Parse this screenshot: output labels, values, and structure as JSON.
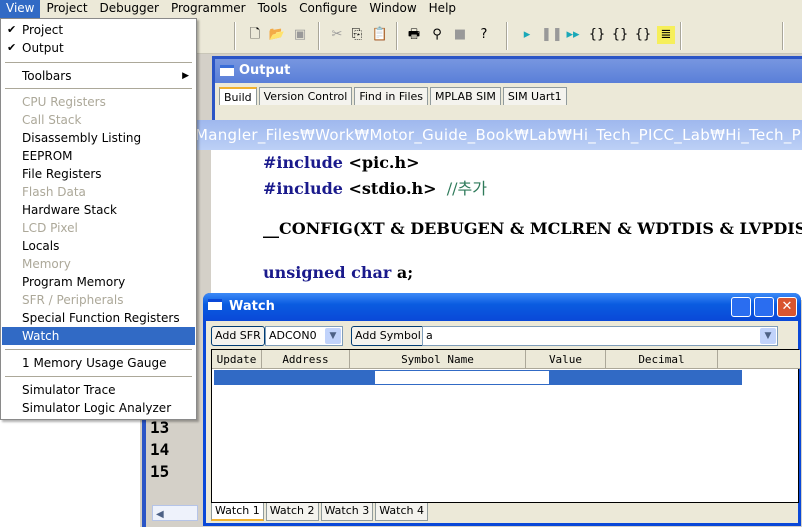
{
  "menubar": [
    "View",
    "Project",
    "Debugger",
    "Programmer",
    "Tools",
    "Configure",
    "Window",
    "Help"
  ],
  "view_menu": {
    "items": [
      {
        "label": "Project",
        "checked": true
      },
      {
        "label": "Output",
        "checked": true
      },
      {
        "label": "Toolbars",
        "submenu": true
      },
      {
        "label": "CPU Registers",
        "disabled": true
      },
      {
        "label": "Call Stack",
        "disabled": true
      },
      {
        "label": "Disassembly Listing"
      },
      {
        "label": "EEPROM"
      },
      {
        "label": "File Registers"
      },
      {
        "label": "Flash Data",
        "disabled": true
      },
      {
        "label": "Hardware Stack"
      },
      {
        "label": "LCD Pixel",
        "disabled": true
      },
      {
        "label": "Locals"
      },
      {
        "label": "Memory",
        "disabled": true
      },
      {
        "label": "Program Memory"
      },
      {
        "label": "SFR / Peripherals",
        "disabled": true
      },
      {
        "label": "Special Function Registers"
      },
      {
        "label": "Watch",
        "highlighted": true
      },
      {
        "label": "1 Memory Usage Gauge"
      },
      {
        "label": "Simulator Trace"
      },
      {
        "label": "Simulator Logic Analyzer"
      }
    ]
  },
  "output": {
    "title": "Output",
    "tabs": [
      "Build",
      "Version Control",
      "Find in Files",
      "MPLAB SIM",
      "SIM Uart1"
    ]
  },
  "editor": {
    "path": "Mangler_Files₩Work₩Motor_Guide_Book₩Lab₩Hi_Tech_PICC_Lab₩Hi_Tech_PICC_",
    "lines": {
      "l1a": "#include ",
      "l1b": "<pic.h>",
      "l2a": "#include ",
      "l2b": "<stdio.h>",
      "l2c": "  //추가",
      "l3": "__CONFIG(XT & DEBUGEN & MCLREN & WDTDIS & LVPDIS);",
      "l4a": "unsigned char ",
      "l4b": "a;"
    },
    "line_numbers": [
      "13",
      "14",
      "15"
    ]
  },
  "watch": {
    "title": "Watch",
    "add_sfr": "Add SFR",
    "sfr_value": "ADCON0",
    "add_symbol": "Add Symbol",
    "symbol_value": "a",
    "columns": [
      "Update",
      "Address",
      "Symbol Name",
      "Value",
      "Decimal"
    ],
    "tabs": [
      "Watch 1",
      "Watch 2",
      "Watch 3",
      "Watch 4"
    ]
  }
}
